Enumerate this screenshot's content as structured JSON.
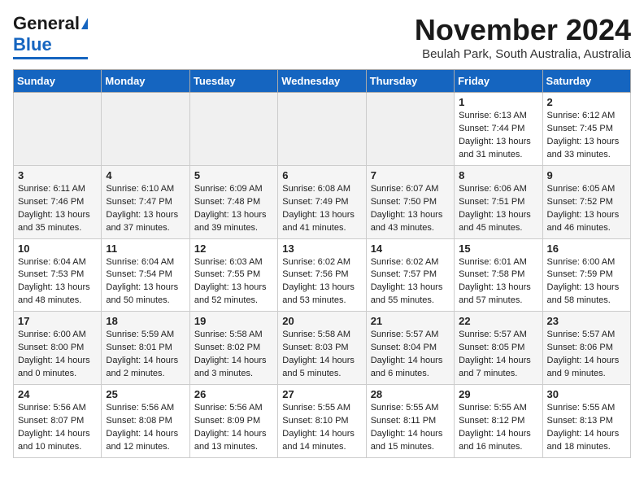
{
  "header": {
    "logo_line1": "General",
    "logo_line2": "Blue",
    "month": "November 2024",
    "location": "Beulah Park, South Australia, Australia"
  },
  "weekdays": [
    "Sunday",
    "Monday",
    "Tuesday",
    "Wednesday",
    "Thursday",
    "Friday",
    "Saturday"
  ],
  "weeks": [
    [
      {
        "day": "",
        "info": ""
      },
      {
        "day": "",
        "info": ""
      },
      {
        "day": "",
        "info": ""
      },
      {
        "day": "",
        "info": ""
      },
      {
        "day": "",
        "info": ""
      },
      {
        "day": "1",
        "info": "Sunrise: 6:13 AM\nSunset: 7:44 PM\nDaylight: 13 hours\nand 31 minutes."
      },
      {
        "day": "2",
        "info": "Sunrise: 6:12 AM\nSunset: 7:45 PM\nDaylight: 13 hours\nand 33 minutes."
      }
    ],
    [
      {
        "day": "3",
        "info": "Sunrise: 6:11 AM\nSunset: 7:46 PM\nDaylight: 13 hours\nand 35 minutes."
      },
      {
        "day": "4",
        "info": "Sunrise: 6:10 AM\nSunset: 7:47 PM\nDaylight: 13 hours\nand 37 minutes."
      },
      {
        "day": "5",
        "info": "Sunrise: 6:09 AM\nSunset: 7:48 PM\nDaylight: 13 hours\nand 39 minutes."
      },
      {
        "day": "6",
        "info": "Sunrise: 6:08 AM\nSunset: 7:49 PM\nDaylight: 13 hours\nand 41 minutes."
      },
      {
        "day": "7",
        "info": "Sunrise: 6:07 AM\nSunset: 7:50 PM\nDaylight: 13 hours\nand 43 minutes."
      },
      {
        "day": "8",
        "info": "Sunrise: 6:06 AM\nSunset: 7:51 PM\nDaylight: 13 hours\nand 45 minutes."
      },
      {
        "day": "9",
        "info": "Sunrise: 6:05 AM\nSunset: 7:52 PM\nDaylight: 13 hours\nand 46 minutes."
      }
    ],
    [
      {
        "day": "10",
        "info": "Sunrise: 6:04 AM\nSunset: 7:53 PM\nDaylight: 13 hours\nand 48 minutes."
      },
      {
        "day": "11",
        "info": "Sunrise: 6:04 AM\nSunset: 7:54 PM\nDaylight: 13 hours\nand 50 minutes."
      },
      {
        "day": "12",
        "info": "Sunrise: 6:03 AM\nSunset: 7:55 PM\nDaylight: 13 hours\nand 52 minutes."
      },
      {
        "day": "13",
        "info": "Sunrise: 6:02 AM\nSunset: 7:56 PM\nDaylight: 13 hours\nand 53 minutes."
      },
      {
        "day": "14",
        "info": "Sunrise: 6:02 AM\nSunset: 7:57 PM\nDaylight: 13 hours\nand 55 minutes."
      },
      {
        "day": "15",
        "info": "Sunrise: 6:01 AM\nSunset: 7:58 PM\nDaylight: 13 hours\nand 57 minutes."
      },
      {
        "day": "16",
        "info": "Sunrise: 6:00 AM\nSunset: 7:59 PM\nDaylight: 13 hours\nand 58 minutes."
      }
    ],
    [
      {
        "day": "17",
        "info": "Sunrise: 6:00 AM\nSunset: 8:00 PM\nDaylight: 14 hours\nand 0 minutes."
      },
      {
        "day": "18",
        "info": "Sunrise: 5:59 AM\nSunset: 8:01 PM\nDaylight: 14 hours\nand 2 minutes."
      },
      {
        "day": "19",
        "info": "Sunrise: 5:58 AM\nSunset: 8:02 PM\nDaylight: 14 hours\nand 3 minutes."
      },
      {
        "day": "20",
        "info": "Sunrise: 5:58 AM\nSunset: 8:03 PM\nDaylight: 14 hours\nand 5 minutes."
      },
      {
        "day": "21",
        "info": "Sunrise: 5:57 AM\nSunset: 8:04 PM\nDaylight: 14 hours\nand 6 minutes."
      },
      {
        "day": "22",
        "info": "Sunrise: 5:57 AM\nSunset: 8:05 PM\nDaylight: 14 hours\nand 7 minutes."
      },
      {
        "day": "23",
        "info": "Sunrise: 5:57 AM\nSunset: 8:06 PM\nDaylight: 14 hours\nand 9 minutes."
      }
    ],
    [
      {
        "day": "24",
        "info": "Sunrise: 5:56 AM\nSunset: 8:07 PM\nDaylight: 14 hours\nand 10 minutes."
      },
      {
        "day": "25",
        "info": "Sunrise: 5:56 AM\nSunset: 8:08 PM\nDaylight: 14 hours\nand 12 minutes."
      },
      {
        "day": "26",
        "info": "Sunrise: 5:56 AM\nSunset: 8:09 PM\nDaylight: 14 hours\nand 13 minutes."
      },
      {
        "day": "27",
        "info": "Sunrise: 5:55 AM\nSunset: 8:10 PM\nDaylight: 14 hours\nand 14 minutes."
      },
      {
        "day": "28",
        "info": "Sunrise: 5:55 AM\nSunset: 8:11 PM\nDaylight: 14 hours\nand 15 minutes."
      },
      {
        "day": "29",
        "info": "Sunrise: 5:55 AM\nSunset: 8:12 PM\nDaylight: 14 hours\nand 16 minutes."
      },
      {
        "day": "30",
        "info": "Sunrise: 5:55 AM\nSunset: 8:13 PM\nDaylight: 14 hours\nand 18 minutes."
      }
    ]
  ]
}
